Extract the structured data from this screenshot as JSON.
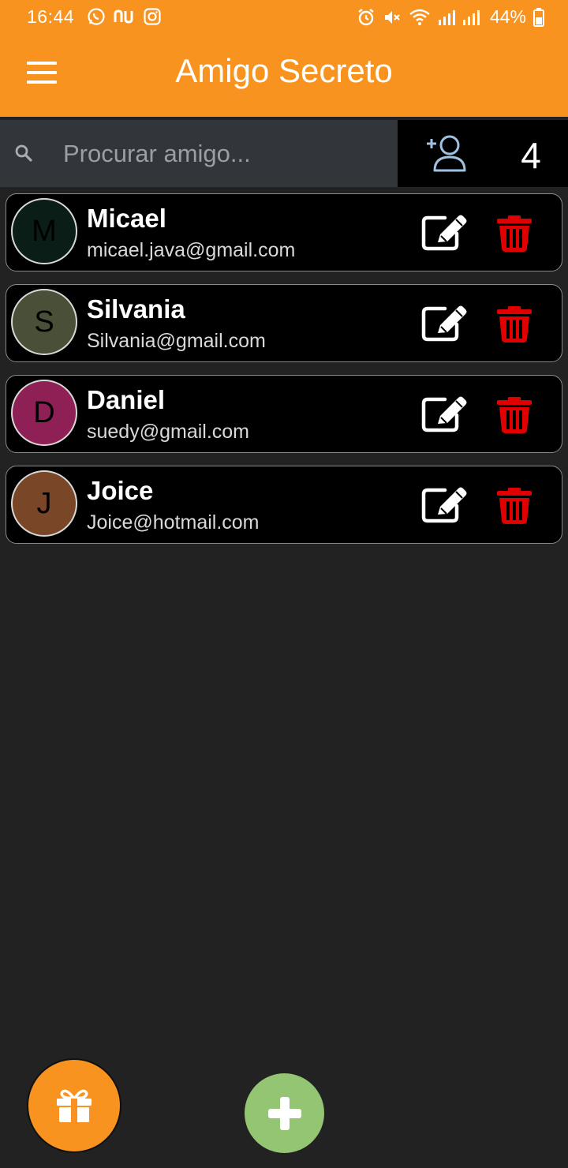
{
  "status_bar": {
    "time": "16:44",
    "battery": "44%"
  },
  "app": {
    "title": "Amigo Secreto"
  },
  "search": {
    "placeholder": "Procurar amigo..."
  },
  "friend_count": "4",
  "friends": [
    {
      "initial": "M",
      "name": "Micael",
      "email": "micael.java@gmail.com",
      "color": "#0B1D17"
    },
    {
      "initial": "S",
      "name": "Silvania",
      "email": "Silvania@gmail.com",
      "color": "#4A4F37"
    },
    {
      "initial": "D",
      "name": "Daniel",
      "email": "suedy@gmail.com",
      "color": "#8E2056"
    },
    {
      "initial": "J",
      "name": "Joice",
      "email": "Joice@hotmail.com",
      "color": "#7A4628"
    }
  ],
  "icons": {
    "menu": "hamburger-menu-icon",
    "search": "search-icon",
    "add_friend": "add-person-icon",
    "edit": "edit-icon",
    "delete": "trash-icon",
    "gift": "gift-icon",
    "add": "plus-icon"
  },
  "colors": {
    "primary": "#F7931E",
    "background": "#222222",
    "delete": "#E00000",
    "add_fab": "#93C572"
  }
}
